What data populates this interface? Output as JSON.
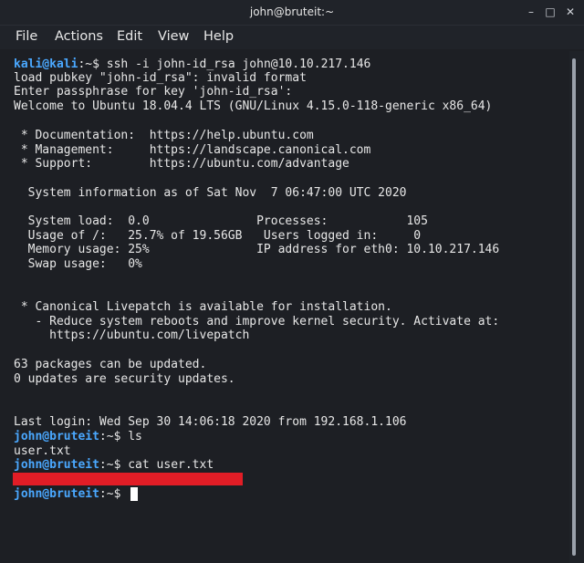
{
  "window": {
    "title": "john@bruteit:~"
  },
  "controls": {
    "minimize_symbol": "–",
    "maximize_symbol": "□",
    "close_symbol": "✕"
  },
  "menu": [
    "File",
    "Actions",
    "Edit",
    "View",
    "Help"
  ],
  "terminal": {
    "prompt_kali_user": "kali@kali",
    "prompt_bruteit_user": "john@bruteit",
    "prompt_path": ":~$ ",
    "cmd_ssh": "ssh -i john-id_rsa john@10.10.217.146",
    "out_load_pubkey": "load pubkey \"john-id_rsa\": invalid format",
    "out_enter_pass": "Enter passphrase for key 'john-id_rsa':",
    "out_welcome": "Welcome to Ubuntu 18.04.4 LTS (GNU/Linux 4.15.0-118-generic x86_64)",
    "out_doc": " * Documentation:  https://help.ubuntu.com",
    "out_mgmt": " * Management:     https://landscape.canonical.com",
    "out_support": " * Support:        https://ubuntu.com/advantage",
    "out_sysinfo": "  System information as of Sat Nov  7 06:47:00 UTC 2020",
    "out_sys_load": "  System load:  0.0               Processes:           105",
    "out_usage": "  Usage of /:   25.7% of 19.56GB   Users logged in:     0",
    "out_memory": "  Memory usage: 25%               IP address for eth0: 10.10.217.146",
    "out_swap": "  Swap usage:   0%",
    "out_livepatch": " * Canonical Livepatch is available for installation.",
    "out_reduce": "   - Reduce system reboots and improve kernel security. Activate at:",
    "out_livepatch_url": "     https://ubuntu.com/livepatch",
    "out_packages": "63 packages can be updated.",
    "out_security": "0 updates are security updates.",
    "out_last_login": "Last login: Wed Sep 30 14:06:18 2020 from 192.168.1.106",
    "cmd_ls": "ls",
    "out_ls": "user.txt",
    "cmd_cat": "cat user.txt"
  },
  "colors": {
    "background": "#1d1f24",
    "prompt_user": "#4aa8ff",
    "redaction": "#e11d26",
    "text": "#e7e7e7"
  }
}
